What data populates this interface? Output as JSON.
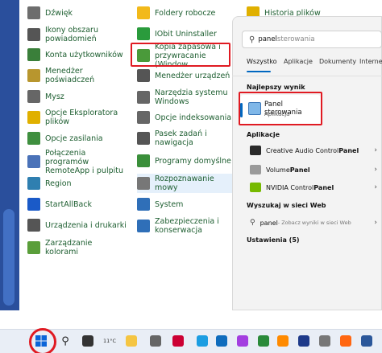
{
  "control_panel": {
    "col1": [
      {
        "label": "Dźwięk",
        "icon": "speaker-icon",
        "color": "#6d6d6d"
      },
      {
        "label": "Ikony obszaru powiadomień",
        "icon": "notification-area-icon",
        "color": "#555555"
      },
      {
        "label": "Konta użytkowników",
        "icon": "users-icon",
        "color": "#3a7f3a"
      },
      {
        "label": "Menedżer poświadczeń",
        "icon": "credentials-icon",
        "color": "#b8962e"
      },
      {
        "label": "Mysz",
        "icon": "mouse-icon",
        "color": "#666666"
      },
      {
        "label": "Opcje Eksploratora plików",
        "icon": "folder-options-icon",
        "color": "#e0b000"
      },
      {
        "label": "Opcje zasilania",
        "icon": "power-icon",
        "color": "#3f8f3f"
      },
      {
        "label": "Połączenia programów RemoteApp i pulpitu",
        "icon": "remoteapp-icon",
        "color": "#4a72b8"
      },
      {
        "label": "Region",
        "icon": "globe-icon",
        "color": "#2f7fb0"
      },
      {
        "label": "StartAllBack",
        "icon": "startallback-icon",
        "color": "#1a5ac8"
      },
      {
        "label": "Urządzenia i drukarki",
        "icon": "printer-icon",
        "color": "#555555"
      },
      {
        "label": "Zarządzanie kolorami",
        "icon": "color-management-icon",
        "color": "#5a9e3a"
      }
    ],
    "col2": [
      {
        "label": "Foldery robocze",
        "icon": "work-folders-icon",
        "color": "#f2b91a"
      },
      {
        "label": "IObit Uninstaller",
        "icon": "iobit-icon",
        "color": "#2a9b3c"
      },
      {
        "label": "Kopia zapasowa i przywracanie (Window...",
        "icon": "backup-icon",
        "color": "#4a9a3a"
      },
      {
        "label": "Menedżer urządzeń",
        "icon": "device-manager-icon",
        "color": "#555555"
      },
      {
        "label": "Narzędzia systemu Windows",
        "icon": "windows-tools-icon",
        "color": "#666666"
      },
      {
        "label": "Opcje indeksowania",
        "icon": "indexing-icon",
        "color": "#666666"
      },
      {
        "label": "Pasek zadań i nawigacja",
        "icon": "taskbar-icon",
        "color": "#555555"
      },
      {
        "label": "Programy domyślne",
        "icon": "default-programs-icon",
        "color": "#3a8f3a"
      },
      {
        "label": "Rozpoznawanie mowy",
        "icon": "microphone-icon",
        "color": "#777777"
      },
      {
        "label": "System",
        "icon": "system-icon",
        "color": "#2f6fb8"
      },
      {
        "label": "Zabezpieczenia i konserwacja",
        "icon": "security-flag-icon",
        "color": "#2f6fb8"
      }
    ],
    "col3": [
      {
        "label": "Historia plików",
        "icon": "file-history-icon",
        "color": "#e0b000"
      }
    ]
  },
  "search": {
    "typed": "panel",
    "rest": " sterowania",
    "tabs": [
      "Wszystko",
      "Aplikacje",
      "Dokumenty",
      "Internet"
    ],
    "best_match_header": "Najlepszy wynik",
    "best_match_title": "Panel sterowania",
    "best_match_subtitle": "Aplikacja",
    "apps_header": "Aplikacje",
    "apps": [
      {
        "pre": "Creative Audio Control ",
        "bold": "Panel",
        "icon_color": "#2a2a2a"
      },
      {
        "pre": "Volume ",
        "bold": "Panel",
        "icon_color": "#9a9a9a"
      },
      {
        "pre": "NVIDIA Control ",
        "bold": "Panel",
        "icon_color": "#76b900"
      }
    ],
    "web_header": "Wyszukaj w sieci Web",
    "web_query": "panel",
    "web_hint": " - Zobacz wyniki w sieci Web",
    "settings_header": "Ustawienia (5)"
  },
  "taskbar": {
    "weather": "11°C",
    "icons": [
      "windows-start-icon",
      "search-icon",
      "task-view-icon",
      "weather-icon",
      "file-explorer-icon",
      "app-icon",
      "app-icon",
      "edge-icon",
      "store-icon",
      "messenger-icon",
      "app-icon",
      "app-icon",
      "app-icon",
      "app-icon",
      "firefox-icon",
      "word-icon"
    ]
  }
}
